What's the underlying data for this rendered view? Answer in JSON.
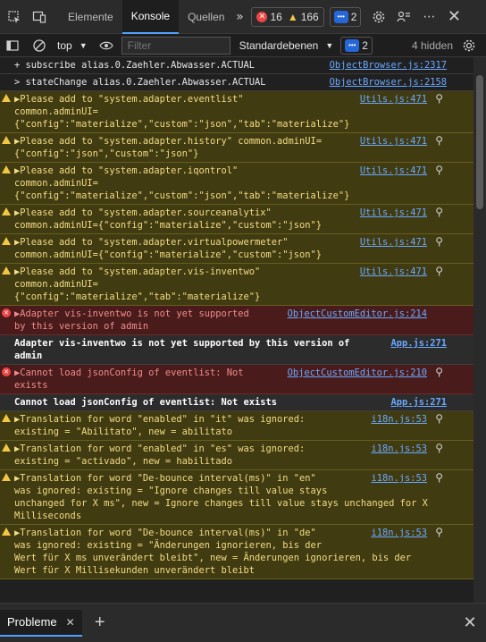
{
  "tabs": {
    "items": [
      "Elemente",
      "Konsole",
      "Quellen"
    ],
    "more_label": "»",
    "errors": "16",
    "warnings": "166",
    "infos": "2"
  },
  "toolbar": {
    "context": "top",
    "filter_placeholder": "Filter",
    "levels": "Standardebenen",
    "info_count": "2",
    "hidden": "4 hidden"
  },
  "console": [
    {
      "type": "log",
      "text": "+ subscribe alias.0.Zaehler.Abwasser.ACTUAL",
      "src": "ObjectBrowser.js:2317"
    },
    {
      "type": "log",
      "text": "> stateChange alias.0.Zaehler.Abwasser.ACTUAL",
      "src": "ObjectBrowser.js:2158"
    },
    {
      "type": "warn",
      "text": "Please add to \"system.adapter.eventlist\"\ncommon.adminUI=\n{\"config\":\"materialize\",\"custom\":\"json\",\"tab\":\"materialize\"}",
      "src": "Utils.js:471"
    },
    {
      "type": "warn",
      "text": "Please add to \"system.adapter.history\" common.adminUI=\n{\"config\":\"json\",\"custom\":\"json\"}",
      "src": "Utils.js:471"
    },
    {
      "type": "warn",
      "text": "Please add to \"system.adapter.iqontrol\"\ncommon.adminUI=\n{\"config\":\"materialize\",\"custom\":\"json\",\"tab\":\"materialize\"}",
      "src": "Utils.js:471"
    },
    {
      "type": "warn",
      "text": "Please add to \"system.adapter.sourceanalytix\"\ncommon.adminUI={\"config\":\"materialize\",\"custom\":\"json\"}",
      "src": "Utils.js:471"
    },
    {
      "type": "warn",
      "text": "Please add to \"system.adapter.virtualpowermeter\"\ncommon.adminUI={\"config\":\"materialize\",\"custom\":\"json\"}",
      "src": "Utils.js:471"
    },
    {
      "type": "warn",
      "text": "Please add to \"system.adapter.vis-inventwo\"\ncommon.adminUI=\n{\"config\":\"materialize\",\"tab\":\"materialize\"}",
      "src": "Utils.js:471"
    },
    {
      "type": "error",
      "text": "Adapter vis-inventwo is not yet supported\nby this version of admin",
      "src": "ObjectCustomEditor.js:214"
    },
    {
      "type": "msg",
      "text": "Adapter vis-inventwo is not yet supported by this version of\nadmin",
      "src": "App.js:271"
    },
    {
      "type": "error",
      "text": "Cannot load jsonConfig of eventlist: Not\nexists",
      "src": "ObjectCustomEditor.js:210"
    },
    {
      "type": "msg",
      "text": "Cannot load jsonConfig of eventlist: Not exists",
      "src": "App.js:271"
    },
    {
      "type": "warn",
      "text": "Translation for word \"enabled\" in \"it\" was ignored:\nexisting = \"Abilitato\", new = abilitato",
      "src": "i18n.js:53"
    },
    {
      "type": "warn",
      "text": "Translation for word \"enabled\" in \"es\" was ignored:\nexisting = \"activado\", new = habilitado",
      "src": "i18n.js:53"
    },
    {
      "type": "warn",
      "text": "Translation for word \"De-bounce interval(ms)\" in \"en\"\nwas ignored: existing = \"Ignore changes till value stays\nunchanged for X ms\", new = Ignore changes till value stays unchanged for X\nMilliseconds",
      "src": "i18n.js:53"
    },
    {
      "type": "warn",
      "text": "Translation for word \"De-bounce interval(ms)\" in \"de\"\nwas ignored: existing = \"Änderungen ignorieren, bis der\nWert für X ms unverändert bleibt\", new = Änderungen ignorieren, bis der\nWert für X Millisekunden unverändert bleibt",
      "src": "i18n.js:53"
    }
  ],
  "drawer": {
    "tab_label": "Probleme"
  }
}
